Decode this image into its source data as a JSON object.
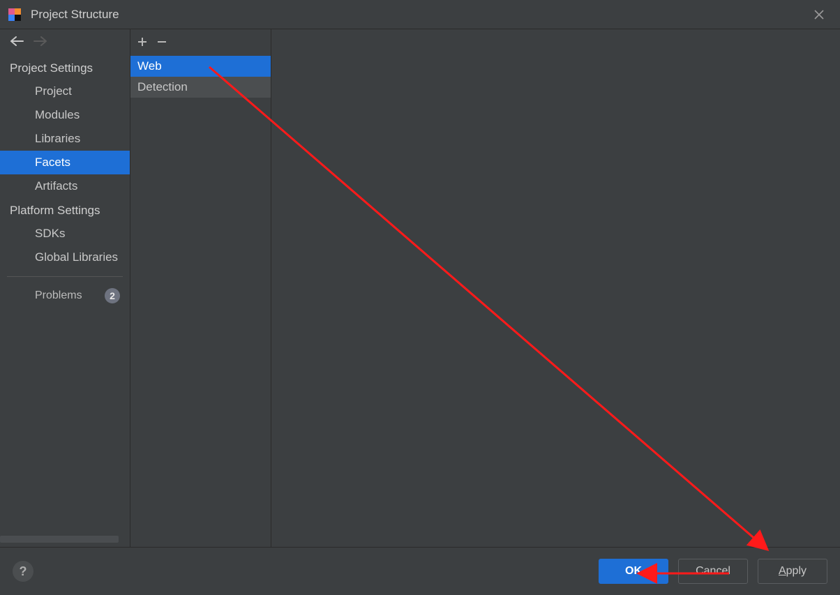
{
  "title": "Project Structure",
  "sidebar": {
    "projectSettingsHeader": "Project Settings",
    "platformSettingsHeader": "Platform Settings",
    "items": {
      "project": "Project",
      "modules": "Modules",
      "libraries": "Libraries",
      "facets": "Facets",
      "artifacts": "Artifacts",
      "sdks": "SDKs",
      "globalLibraries": "Global Libraries",
      "problems": "Problems"
    },
    "problemsCount": "2",
    "selected": "facets"
  },
  "facets": {
    "items": {
      "web": "Web",
      "detection": "Detection"
    },
    "selected": "web"
  },
  "footer": {
    "ok": "OK",
    "cancel": "Cancel",
    "applyPrefix": "A",
    "applyRest": "pply"
  }
}
